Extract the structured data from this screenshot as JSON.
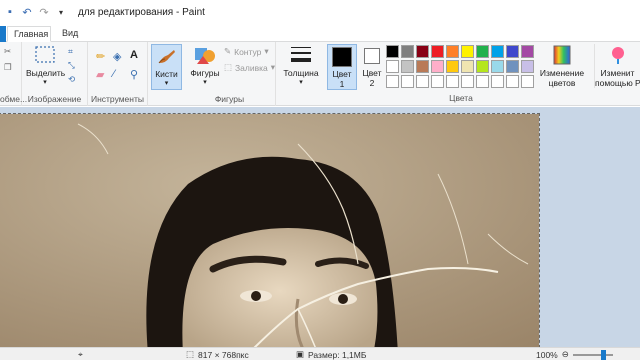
{
  "window": {
    "title": "для редактирования - Paint"
  },
  "tabs": {
    "home": "Главная",
    "view": "Вид"
  },
  "ribbon": {
    "clipboard": {
      "label": "обме..."
    },
    "image": {
      "select_label": "Выделить",
      "group_label": "Изображение"
    },
    "tools": {
      "group_label": "Инструменты"
    },
    "brushes": {
      "label": "Кисти"
    },
    "shapes": {
      "label": "Фигуры",
      "outline": "Контур",
      "fill": "Заливка",
      "group_label": "Фигуры"
    },
    "size": {
      "label": "Толщина"
    },
    "colors": {
      "color1_label": "Цвет",
      "color1_num": "1",
      "color2_label": "Цвет",
      "color2_num": "2",
      "group_label": "Цвета",
      "edit_label_1": "Изменение",
      "edit_label_2": "цветов",
      "paint3d_label_1": "Изменит",
      "paint3d_label_2": "помощью P",
      "palette": [
        "#000000",
        "#7f7f7f",
        "#880015",
        "#ed1c24",
        "#ff7f27",
        "#fff200",
        "#22b14c",
        "#00a2e8",
        "#3f48cc",
        "#a349a4",
        "#ffffff",
        "#c3c3c3",
        "#b97a57",
        "#ffaec9",
        "#ffc90e",
        "#efe4b0",
        "#b5e61d",
        "#99d9ea",
        "#7092be",
        "#c8bfe7",
        "#ffffff",
        "#ffffff",
        "#ffffff",
        "#ffffff",
        "#ffffff",
        "#ffffff",
        "#ffffff",
        "#ffffff",
        "#ffffff",
        "#ffffff"
      ]
    }
  },
  "status": {
    "dimensions": "817 × 768пкс",
    "size": "Размер: 1,1МБ",
    "zoom": "100%"
  }
}
